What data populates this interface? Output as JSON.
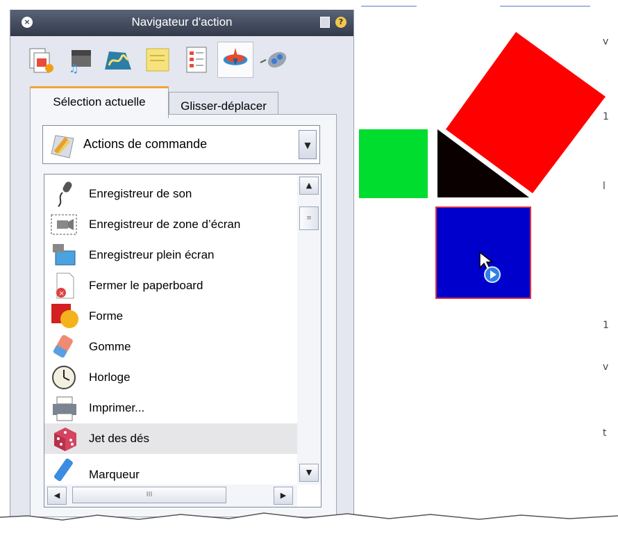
{
  "panel": {
    "title": "Navigateur d'action",
    "close_symbol": "×",
    "help_symbol": "?",
    "toolbar_icons": [
      "page-properties-icon",
      "media-icon",
      "ink-icon",
      "notes-icon",
      "checklist-icon",
      "actions-icon",
      "devices-icon"
    ],
    "active_tool_index": 5
  },
  "tabs": {
    "current_selection": "Sélection actuelle",
    "drag_drop": "Glisser-déplacer"
  },
  "dropdown": {
    "value": "Actions de commande",
    "icon": "command-actions-icon"
  },
  "list": {
    "items": [
      {
        "label": "Enregistreur de son",
        "icon": "microphone-icon"
      },
      {
        "label": "Enregistreur de zone d’écran",
        "icon": "area-recorder-icon"
      },
      {
        "label": "Enregistreur plein écran",
        "icon": "fullscreen-recorder-icon"
      },
      {
        "label": "Fermer le paperboard",
        "icon": "close-flipchart-icon"
      },
      {
        "label": "Forme",
        "icon": "shape-icon"
      },
      {
        "label": "Gomme",
        "icon": "eraser-icon"
      },
      {
        "label": "Horloge",
        "icon": "clock-icon"
      },
      {
        "label": "Imprimer...",
        "icon": "printer-icon"
      },
      {
        "label": "Jet des dés",
        "icon": "dice-icon"
      },
      {
        "label": "Marqueur",
        "icon": "marker-icon"
      }
    ],
    "selected_index": 8,
    "hscroll_grip": "III",
    "vscroll_grip": "≡"
  },
  "canvas": {
    "colors": {
      "green": "#00dd2e",
      "black": "#0a0000",
      "red": "#ff0000",
      "blue": "#0000cc",
      "blue_border": "#e03040"
    },
    "cursor_icon": "pointer-with-action-icon"
  }
}
